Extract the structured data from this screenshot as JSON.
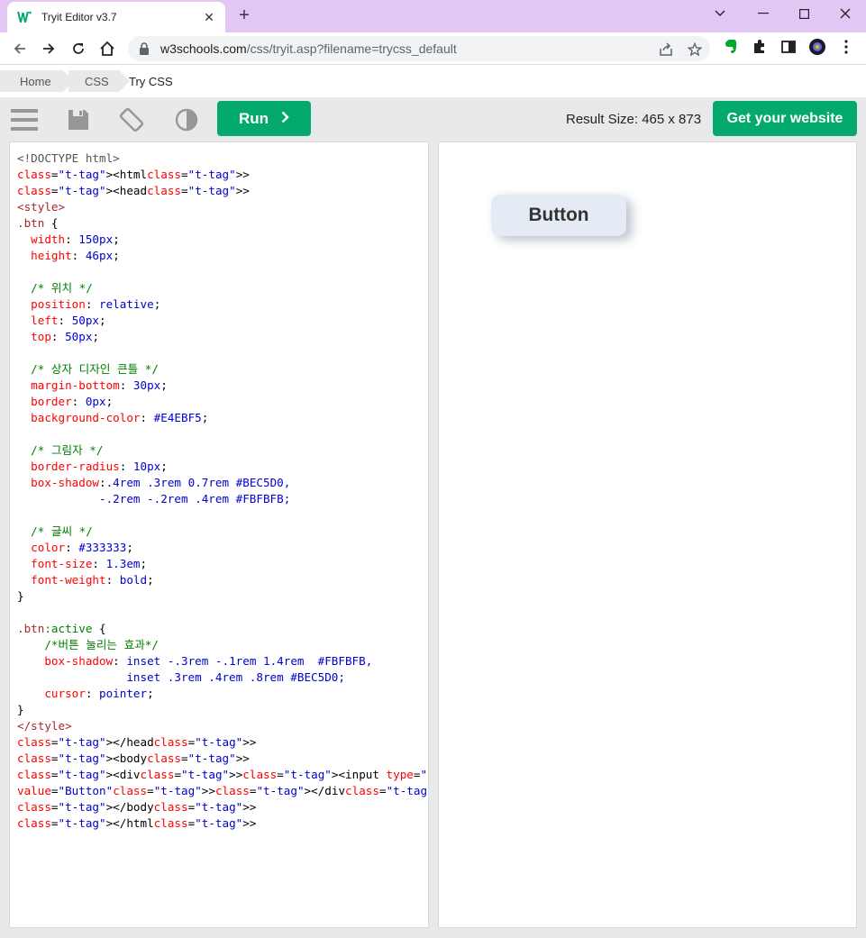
{
  "browser": {
    "tab_title": "Tryit Editor v3.7",
    "url_host": "w3schools.com",
    "url_path": "/css/tryit.asp?filename=trycss_default"
  },
  "breadcrumb": [
    "Home",
    "CSS",
    "Try CSS"
  ],
  "toolbar": {
    "run_label": "Run",
    "result_size": "Result Size: 465 x 873",
    "get_website": "Get your website"
  },
  "colors": {
    "accent": "#04aa6d",
    "tabbar": "#e2c7f4",
    "demo_bg": "#E4EBF5"
  },
  "icons": [
    "back-icon",
    "forward-icon",
    "reload-icon",
    "home-icon",
    "lock-icon",
    "share-icon",
    "star-icon",
    "evernote-icon",
    "extensions-icon",
    "sidepanel-icon",
    "profile-icon",
    "menu-icon",
    "hamburger-icon",
    "save-icon",
    "rotate-icon",
    "contrast-icon"
  ],
  "code_lines": [
    "<!DOCTYPE html>",
    "<html>",
    "<head>",
    "<style>",
    ".btn {",
    "  width: 150px;",
    "  height: 46px;",
    "",
    "  /* 위치 */",
    "  position: relative;",
    "  left: 50px;",
    "  top: 50px;",
    "",
    "  /* 상자 디자인 큰틀 */",
    "  margin-bottom: 30px;",
    "  border: 0px;",
    "  background-color: #E4EBF5;",
    "",
    "  /* 그림자 */",
    "  border-radius: 10px;",
    "  box-shadow:.4rem .3rem 0.7rem #BEC5D0,",
    "            -.2rem -.2rem .4rem #FBFBFB;",
    "",
    "  /* 글씨 */",
    "  color: #333333;",
    "  font-size: 1.3em;",
    "  font-weight: bold;",
    "}",
    "",
    ".btn:active {",
    "    /*버튼 눌리는 효과*/",
    "    box-shadow: inset -.3rem -.1rem 1.4rem  #FBFBFB,",
    "                inset .3rem .4rem .8rem #BEC5D0;",
    "    cursor: pointer;",
    "}",
    "</style>",
    "</head>",
    "<body>",
    "<div><input type=\"button\" class=\"btn\" name=\"btn\"",
    "value=\"Button\"></div>",
    "</body>",
    "</html>"
  ],
  "result": {
    "button_value": "Button"
  }
}
